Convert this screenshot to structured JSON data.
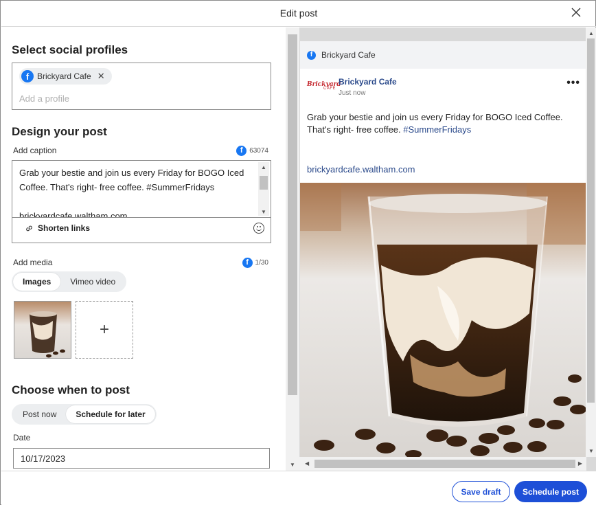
{
  "dialog": {
    "title": "Edit post"
  },
  "left": {
    "profiles_heading": "Select social profiles",
    "profile_chip": "Brickyard Cafe",
    "profile_placeholder": "Add a profile",
    "design_heading": "Design your post",
    "caption_label": "Add caption",
    "caption_counter": "63074",
    "caption_text": "Grab your bestie and join us every Friday for BOGO Iced Coffee. That's right- free coffee. #SummerFridays\n\nbrickyardcafe.waltham.com",
    "shorten_links": "Shorten links",
    "media_label": "Add media",
    "media_counter": "1/30",
    "media_tabs": [
      "Images",
      "Vimeo video"
    ],
    "media_add": "+",
    "when_heading": "Choose when to post",
    "when_tabs": [
      "Post now",
      "Schedule for later"
    ],
    "date_label": "Date",
    "date_value": "10/17/2023"
  },
  "preview": {
    "network_label": "Brickyard Cafe",
    "page_name": "Brickyard Cafe",
    "timestamp": "Just now",
    "logo_text_1": "Brickyard",
    "logo_text_2": "CAFE",
    "more": "•••",
    "text_main": "Grab your bestie and join us every Friday for BOGO Iced Coffee. That's right- free coffee. ",
    "hashtag": "#SummerFridays",
    "link": "brickyardcafe.waltham.com"
  },
  "footer": {
    "save_draft": "Save draft",
    "schedule": "Schedule post"
  },
  "colors": {
    "primary": "#1d4fd7",
    "facebook": "#1877f2",
    "link": "#2b4a8b",
    "brand_red": "#c5282f"
  },
  "icons": {
    "fb": "f",
    "close": "close-icon",
    "link": "link-icon",
    "emoji": "emoji-icon",
    "chip_remove": "✕"
  }
}
